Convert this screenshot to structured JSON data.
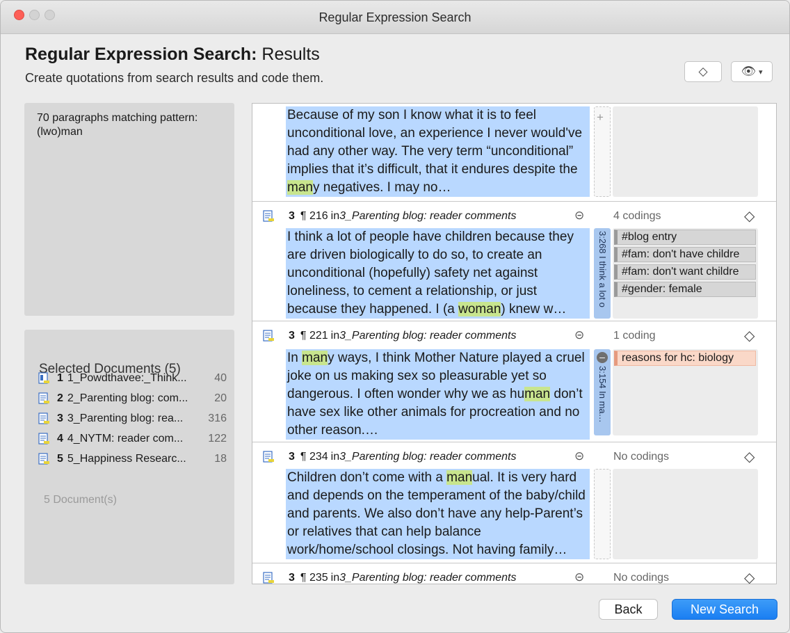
{
  "window": {
    "title": "Regular Expression Search"
  },
  "header": {
    "title_bold": "Regular Expression Search:",
    "title_rest": " Results",
    "subtitle": "Create quotations from search results and code them."
  },
  "toolbar": {
    "code_icon": "diamond-icon",
    "view_icon": "eye-icon",
    "view_menu_icon": "chevron-down-icon"
  },
  "match_panel": {
    "text": "70 paragraphs matching pattern: (lwo)man"
  },
  "selected_documents": {
    "title": "Selected Documents (5)",
    "items": [
      {
        "num": "1",
        "name": "1_Powdthavee:_Think...",
        "count": "40"
      },
      {
        "num": "2",
        "name": "2_Parenting blog: com...",
        "count": "20"
      },
      {
        "num": "3",
        "name": "3_Parenting blog: rea...",
        "count": "316"
      },
      {
        "num": "4",
        "name": "4_NYTM: reader com...",
        "count": "122"
      },
      {
        "num": "5",
        "name": "5_Happiness Researc...",
        "count": "18"
      }
    ],
    "total": "5 Document(s)"
  },
  "results": [
    {
      "quote_parts": [
        "Because of my son I know what it is to feel unconditional love, an experience I never would've had any other way. The very term “unconditional” implies that it’s difficult, that it endures despite the ",
        "man",
        "y negatives. I may no…"
      ]
    },
    {
      "doc": "3",
      "para": "¶ 216",
      "in": " in ",
      "source": "3_Parenting blog: reader comments",
      "codings": "4 codings",
      "quote_parts": [
        "I think a lot of people have children because they are driven biologically to do so, to create an unconditional (hopefully) safety net against loneliness, to cement a relationship, or just because they happened. I (a ",
        "woman",
        ") knew w…"
      ],
      "quotation_label": "3:268 I think a lot o",
      "codes": [
        "#blog entry",
        "#fam: don't have childre",
        "#fam: don't want childre",
        "#gender: female"
      ]
    },
    {
      "doc": "3",
      "para": "¶ 221",
      "in": " in ",
      "source": "3_Parenting blog: reader comments",
      "codings": "1 coding",
      "quote_parts": [
        "In ",
        "man",
        "y ways, I think Mother Nature played a cruel joke on us making sex so pleasurable yet so dangerous. I often wonder why we as hu",
        "man",
        " don’t have sex like other animals for procreation and no other reason.…"
      ],
      "quotation_label": "3:154 In ma…",
      "codes": [
        "reasons for hc: biology"
      ]
    },
    {
      "doc": "3",
      "para": "¶ 234",
      "in": " in ",
      "source": "3_Parenting blog: reader comments",
      "codings": "No codings",
      "quote_parts": [
        "Children don’t come with a ",
        "man",
        "ual. It is very hard and depends on the temperament of the baby/child and parents. We also don’t have any help-Parent’s or relatives that can help balance work/home/school closings. Not having family…"
      ]
    },
    {
      "doc": "3",
      "para": "¶ 235",
      "in": " in ",
      "source": "3_Parenting blog: reader comments",
      "codings": "No codings"
    }
  ],
  "buttons": {
    "back": "Back",
    "new_search": "New Search"
  },
  "colors": {
    "quote_bg": "#b9d8ff",
    "match_highlight": "#c8e58e",
    "primary_button": "#1a7ef2",
    "close_light": "#fd5f57"
  }
}
